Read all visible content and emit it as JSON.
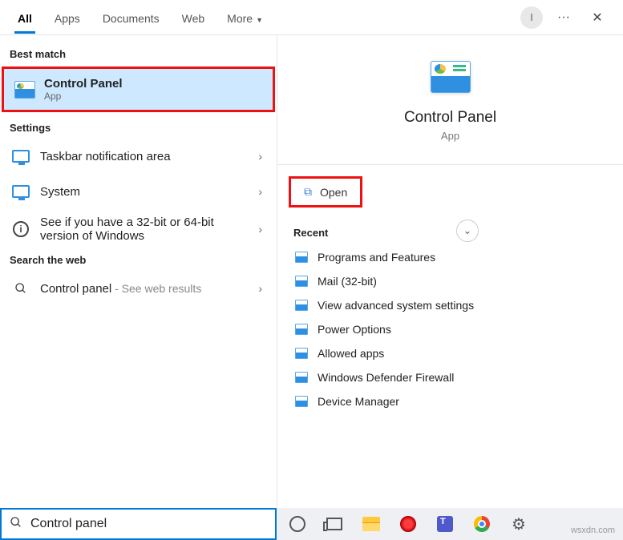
{
  "header": {
    "tabs": [
      "All",
      "Apps",
      "Documents",
      "Web",
      "More"
    ],
    "active_tab": 0,
    "avatar_initial": "I"
  },
  "left": {
    "best_match_label": "Best match",
    "best_match": {
      "title": "Control Panel",
      "subtitle": "App"
    },
    "settings_label": "Settings",
    "settings": [
      {
        "title": "Taskbar notification area"
      },
      {
        "title": "System"
      },
      {
        "title": "See if you have a 32-bit or 64-bit version of Windows"
      }
    ],
    "web_label": "Search the web",
    "web_item": {
      "title": "Control panel",
      "suffix": " - See web results"
    }
  },
  "right": {
    "title": "Control Panel",
    "subtitle": "App",
    "open_label": "Open",
    "recent_label": "Recent",
    "recent": [
      "Programs and Features",
      "Mail (32-bit)",
      "View advanced system settings",
      "Power Options",
      "Allowed apps",
      "Windows Defender Firewall",
      "Device Manager"
    ]
  },
  "search": {
    "value": "Control panel"
  },
  "watermark": "wsxdn.com"
}
